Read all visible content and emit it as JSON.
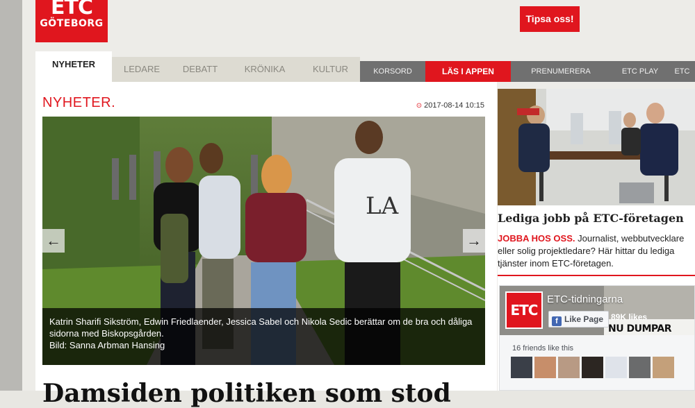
{
  "logo": {
    "line1": "ETC",
    "line2": "GÖTEBORG"
  },
  "tip_button": "Tipsa oss!",
  "tabs": [
    "NYHETER",
    "LEDARE",
    "DEBATT",
    "KRÖNIKA",
    "KULTUR"
  ],
  "secondary_nav": [
    "KORSORD",
    "LÄS I APPEN",
    "PRENUMERERA",
    "ETC PLAY",
    "ETC"
  ],
  "article": {
    "section": "NYHETER.",
    "date": "2017-08-14 10:15",
    "caption": "Katrin Sharifi Sikström, Edwin Friedlaender, Jessica Sabel och Nikola Sedic berättar om de bra och dåliga sidorna med Biskopsgården.",
    "credit": "Bild: Sanna Arbman Hansing",
    "headline": "Damsiden politiken som stod"
  },
  "sidebar": {
    "ad_title": "Lediga jobb på ETC-företagen",
    "ad_lead": "JOBBA HOS OSS.",
    "ad_text": "Journalist, webbutvecklare eller solig projektledare? Här hittar du lediga tjänster inom ETC-företagen."
  },
  "facebook": {
    "logo": "ETC",
    "page_name": "ETC-tidningarna",
    "like_label": "Like Page",
    "likes": "89K likes",
    "cover_text": "NU DUMPAR",
    "friends_text": "16 friends like this"
  },
  "colors": {
    "brand_red": "#e0161e",
    "nav_grey": "#707070",
    "background": "#edece8"
  }
}
